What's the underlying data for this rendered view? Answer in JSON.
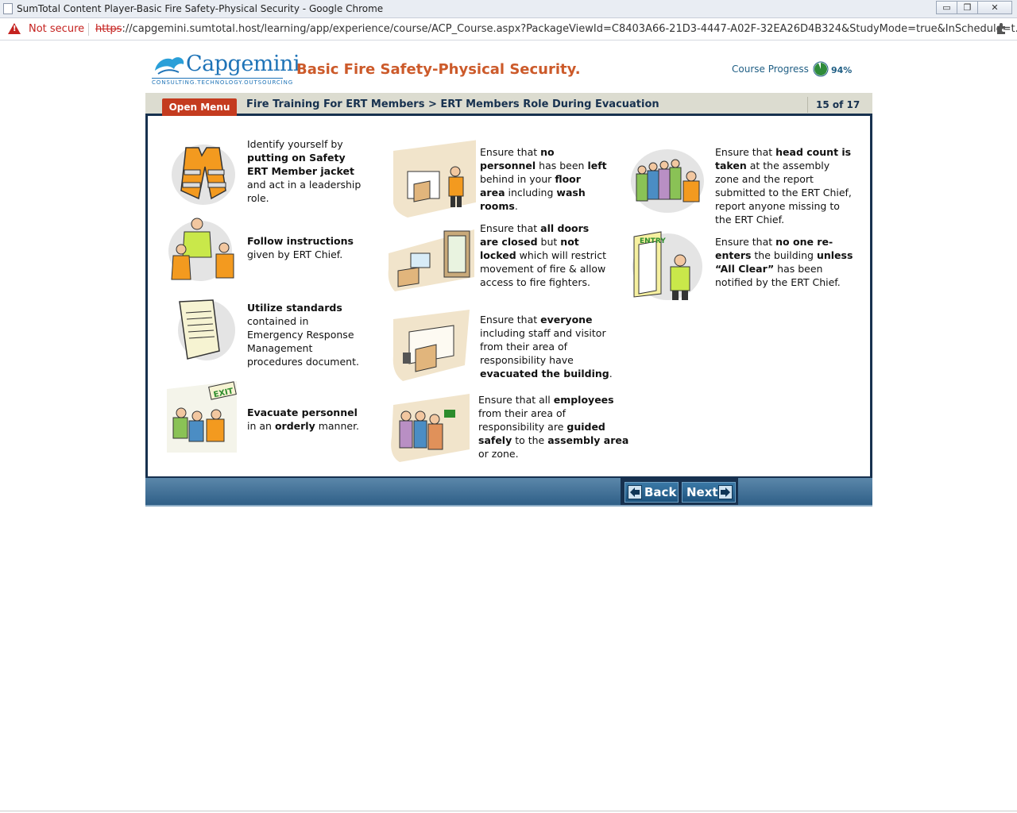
{
  "browser": {
    "window_title": "SumTotal Content Player-Basic Fire Safety-Physical Security - Google Chrome",
    "security_label": "Not secure",
    "url_scheme": "https",
    "url_rest": "://capgemini.sumtotal.host/learning/app/experience/course/ACP_Course.aspx?PackageViewId=C8403A66-21D3-4447-A02F-32EA26D4B324&StudyMode=true&InSchedule=t...",
    "minimize_glyph": "▭",
    "restore_glyph": "❐",
    "close_glyph": "✕"
  },
  "header": {
    "logo_text": "Capgemini",
    "logo_tagline": "CONSULTING.TECHNOLOGY.OUTSOURCING",
    "course_title": "Basic Fire Safety-Physical Security.",
    "progress_label": "Course Progress",
    "progress_value": "94%",
    "progress_fraction": 0.94
  },
  "nav": {
    "open_menu_label": "Open Menu",
    "breadcrumb": "Fire Training For ERT Members > ERT Members Role During Evacuation",
    "page_count": "15 of 17"
  },
  "items": [
    {
      "icon": "safety-jacket-icon",
      "parts": [
        [
          "Identify yourself by ",
          false
        ],
        [
          "putting on Safety ERT Member jacket",
          true
        ],
        [
          " and act in a leadership role.",
          false
        ]
      ]
    },
    {
      "icon": "ert-chief-icon",
      "parts": [
        [
          "Follow instructions",
          true
        ],
        [
          " given by ERT Chief.",
          false
        ]
      ]
    },
    {
      "icon": "document-icon",
      "parts": [
        [
          "Utilize standards",
          true
        ],
        [
          " contained in Emergency Response Management procedures document.",
          false
        ]
      ]
    },
    {
      "icon": "exit-sign-icon",
      "parts": [
        [
          "Evacuate personnel",
          true
        ],
        [
          " in an ",
          false
        ],
        [
          "orderly",
          true
        ],
        [
          " manner.",
          false
        ]
      ]
    },
    {
      "icon": "floor-check-icon",
      "parts": [
        [
          "Ensure that ",
          false
        ],
        [
          "no personnel",
          true
        ],
        [
          " has been ",
          false
        ],
        [
          "left",
          true
        ],
        [
          " behind in your ",
          false
        ],
        [
          "floor area",
          true
        ],
        [
          " including ",
          false
        ],
        [
          "wash rooms",
          true
        ],
        [
          ".",
          false
        ]
      ]
    },
    {
      "icon": "doors-closed-icon",
      "parts": [
        [
          "Ensure that ",
          false
        ],
        [
          "all doors are closed",
          true
        ],
        [
          " but ",
          false
        ],
        [
          "not locked",
          true
        ],
        [
          " which will restrict movement of fire & allow access to fire fighters.",
          false
        ]
      ]
    },
    {
      "icon": "empty-office-icon",
      "parts": [
        [
          "Ensure that ",
          false
        ],
        [
          "everyone",
          true
        ],
        [
          " including staff and visitor from their area of responsibility have ",
          false
        ],
        [
          "evacuated the building",
          true
        ],
        [
          ".",
          false
        ]
      ]
    },
    {
      "icon": "assembly-guide-icon",
      "parts": [
        [
          "Ensure that all ",
          false
        ],
        [
          "employees",
          true
        ],
        [
          " from their area of responsibility are ",
          false
        ],
        [
          "guided safely",
          true
        ],
        [
          " to the ",
          false
        ],
        [
          "assembly area",
          true
        ],
        [
          " or zone.",
          false
        ]
      ]
    },
    {
      "icon": "head-count-icon",
      "parts": [
        [
          "Ensure that ",
          false
        ],
        [
          "head count is taken",
          true
        ],
        [
          " at the assembly zone and the report submitted to the ERT Chief, report anyone missing to the ERT Chief.",
          false
        ]
      ]
    },
    {
      "icon": "no-reentry-icon",
      "parts": [
        [
          "Ensure that ",
          false
        ],
        [
          "no one re-enters",
          true
        ],
        [
          " the building ",
          false
        ],
        [
          "unless “All Clear”",
          true
        ],
        [
          " has been notified by the ERT Chief.",
          false
        ]
      ]
    }
  ],
  "footer": {
    "back_label": "Back",
    "next_label": "Next"
  },
  "colors": {
    "brand_blue": "#1e73b7",
    "title_orange": "#cc5a2a",
    "menu_red": "#c43b1f",
    "navy": "#17314f"
  }
}
